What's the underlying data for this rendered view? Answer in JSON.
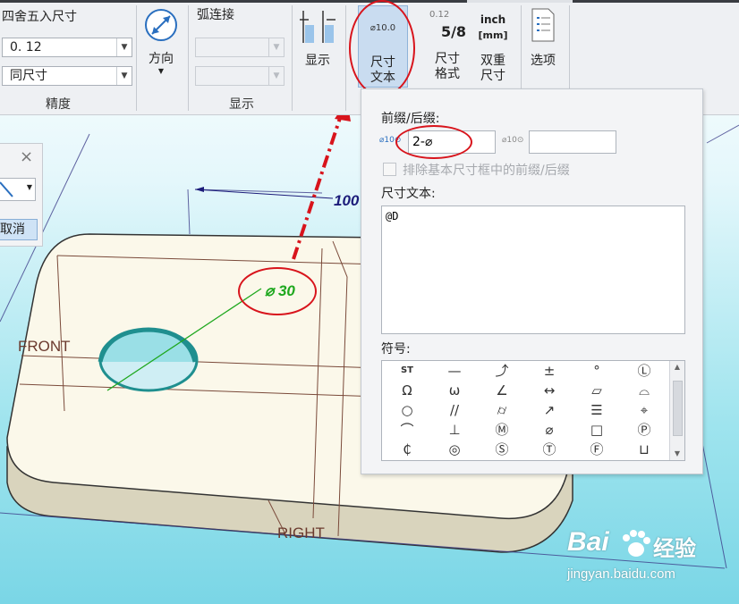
{
  "ribbon": {
    "precision_group": {
      "rounding_label": "四舍五入尺寸",
      "decimal_value": "0. 12",
      "tolerance_value": "同尺寸",
      "title": "精度"
    },
    "direction_label": "方向",
    "arc_group": {
      "arc_label": "弧连接",
      "title": "显示"
    },
    "display_button_label": "显示",
    "dim_text_button": {
      "label_line1": "尺寸",
      "label_line2": "文本",
      "icon_text": "⌀10.0"
    },
    "dim_format_button": {
      "label_line1": "尺寸",
      "label_line2": "格式",
      "icon_top": "0.12",
      "icon_frac": "5/8"
    },
    "dual_dim_button": {
      "label_line1": "双重",
      "label_line2": "尺寸",
      "icon_top": "inch",
      "icon_bottom": "[mm]"
    },
    "options_button_label": "选项"
  },
  "small_dialog": {
    "close_glyph": "×",
    "cancel_label": "取消"
  },
  "panel": {
    "prefix_suffix_label": "前缀/后缀:",
    "prefix_icon": "⌀10⊙",
    "prefix_value": "2-⌀",
    "suffix_icon": "⌀10⊙",
    "suffix_value": "",
    "exclude_label": "排除基本尺寸框中的前缀/后缀",
    "dim_text_label": "尺寸文本:",
    "dim_text_value": "@D",
    "symbols_label": "符号:",
    "symbols": [
      [
        "ST",
        "—",
        "⤴",
        "±",
        "°",
        "Ⓛ"
      ],
      [
        "Ω",
        "ω",
        "∠",
        "↔",
        "▱",
        "⌓"
      ],
      [
        "○",
        "//",
        "⌭",
        "↗",
        "☰",
        "⌖"
      ],
      [
        "⌒",
        "⊥",
        "Ⓜ",
        "⌀",
        "□",
        "Ⓟ"
      ],
      [
        "₵",
        "◎",
        "Ⓢ",
        "Ⓣ",
        "Ⓕ",
        "⊔"
      ]
    ]
  },
  "model": {
    "front_label": "FRONT",
    "right_label": "RIGHT",
    "dim_top": "100",
    "dim_hole": "⌀ 30"
  },
  "watermark": {
    "brand": "Bai",
    "brand_cn": "经验",
    "site": "jingyan.baidu.com"
  },
  "colors": {
    "accent_red": "#d8141c",
    "dimension_green": "#1fa81f",
    "dimension_navy": "#1c1c7a",
    "plate_top": "#fbf8ea",
    "hole_edge": "#1f8f8f"
  }
}
